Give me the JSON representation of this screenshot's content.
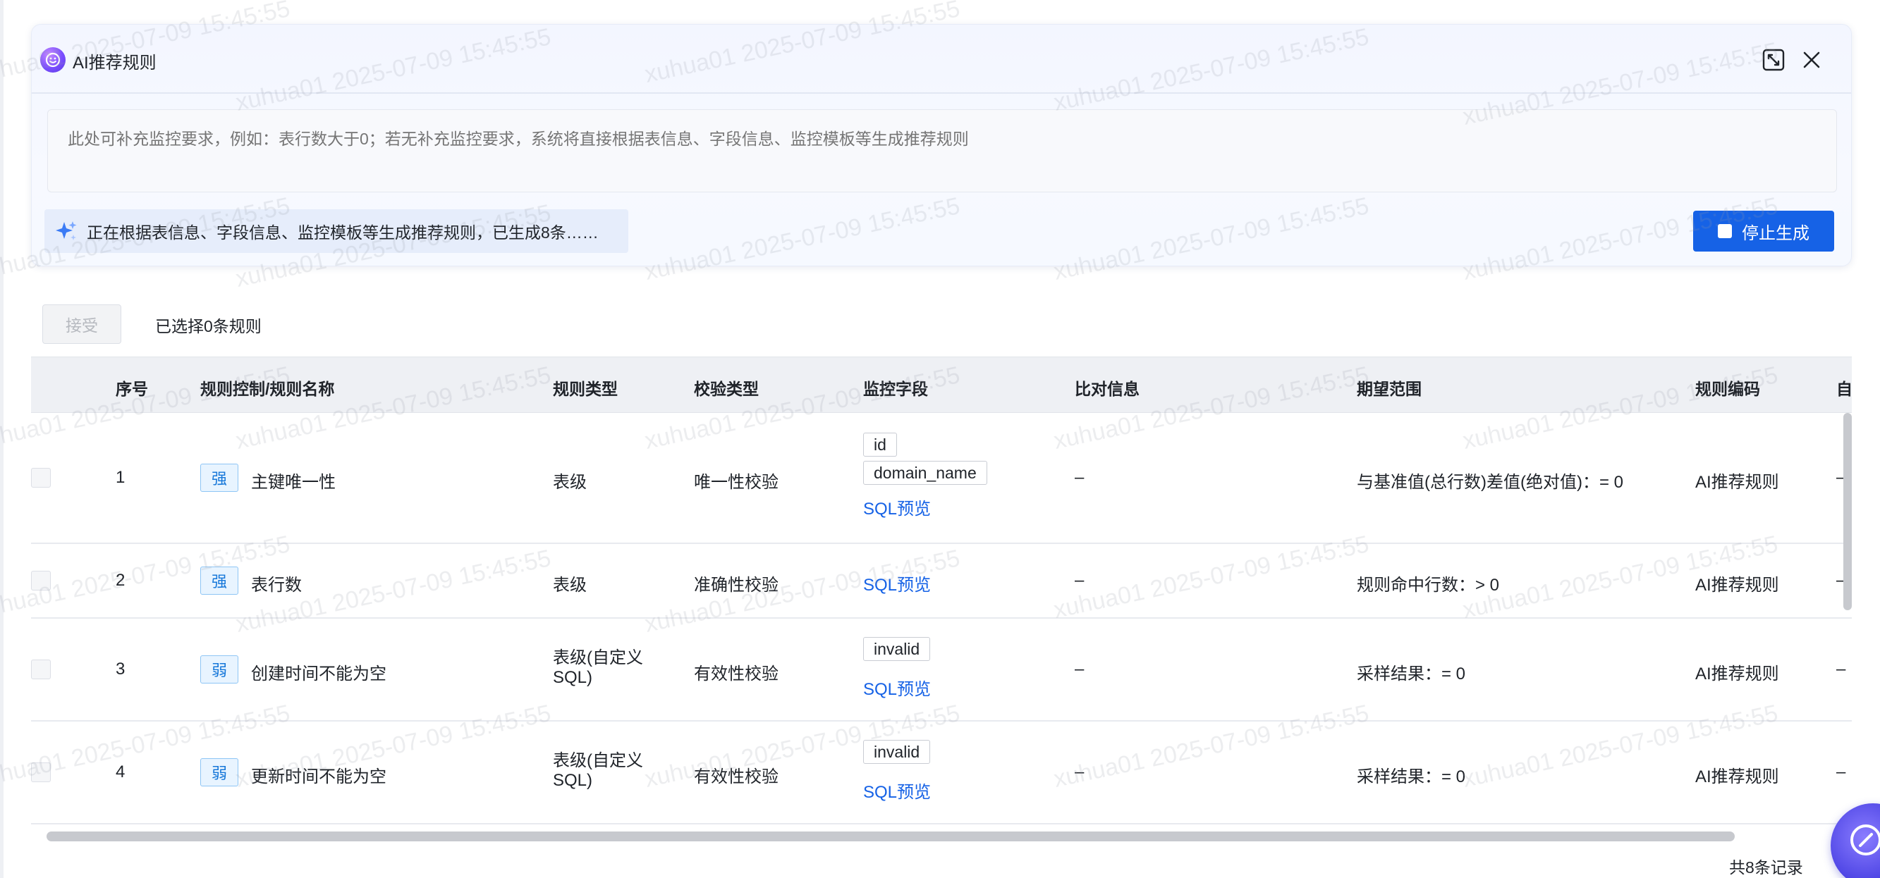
{
  "panel": {
    "title": "AI推荐规则",
    "textarea_placeholder": "此处可补充监控要求，例如：表行数大于0；若无补充监控要求，系统将直接根据表信息、字段信息、监控模板等生成推荐规则",
    "status_text": "正在根据表信息、字段信息、监控模板等生成推荐规则，已生成8条……",
    "stop_label": "停止生成"
  },
  "toolbar": {
    "accept_label": "接受",
    "selected_text": "已选择0条规则"
  },
  "table": {
    "headers": [
      "序号",
      "规则控制/规则名称",
      "规则类型",
      "校验类型",
      "监控字段",
      "比对信息",
      "期望范围",
      "规则编码",
      "自"
    ],
    "rows": [
      {
        "index": "1",
        "strength": "强",
        "name": "主键唯一性",
        "rule_type": "表级",
        "check_type": "唯一性校验",
        "fields": [
          "id",
          "domain_name"
        ],
        "sql": "SQL预览",
        "compare": "–",
        "expected": "与基准值(总行数)差值(绝对值)：= 0",
        "code": "AI推荐规则",
        "extra": "–"
      },
      {
        "index": "2",
        "strength": "强",
        "name": "表行数",
        "rule_type": "表级",
        "check_type": "准确性校验",
        "fields": [],
        "sql": "SQL预览",
        "compare": "–",
        "expected": "规则命中行数：> 0",
        "code": "AI推荐规则",
        "extra": "–"
      },
      {
        "index": "3",
        "strength": "弱",
        "name": "创建时间不能为空",
        "rule_type": "表级(自定义SQL)",
        "check_type": "有效性校验",
        "fields": [
          "invalid"
        ],
        "sql": "SQL预览",
        "compare": "–",
        "expected": "采样结果：= 0",
        "code": "AI推荐规则",
        "extra": "–"
      },
      {
        "index": "4",
        "strength": "弱",
        "name": "更新时间不能为空",
        "rule_type": "表级(自定义SQL)",
        "check_type": "有效性校验",
        "fields": [
          "invalid"
        ],
        "sql": "SQL预览",
        "compare": "–",
        "expected": "采样结果：= 0",
        "code": "AI推荐规则",
        "extra": "–"
      }
    ]
  },
  "footer": {
    "total_text": "共8条记录"
  },
  "watermark": "xuhua01 2025-07-09 15:45:55",
  "colors": {
    "primary": "#1662e6",
    "tag_border": "#8ec5f5",
    "tag_bg": "#e8f4ff",
    "header_bg": "#eef0f4"
  }
}
